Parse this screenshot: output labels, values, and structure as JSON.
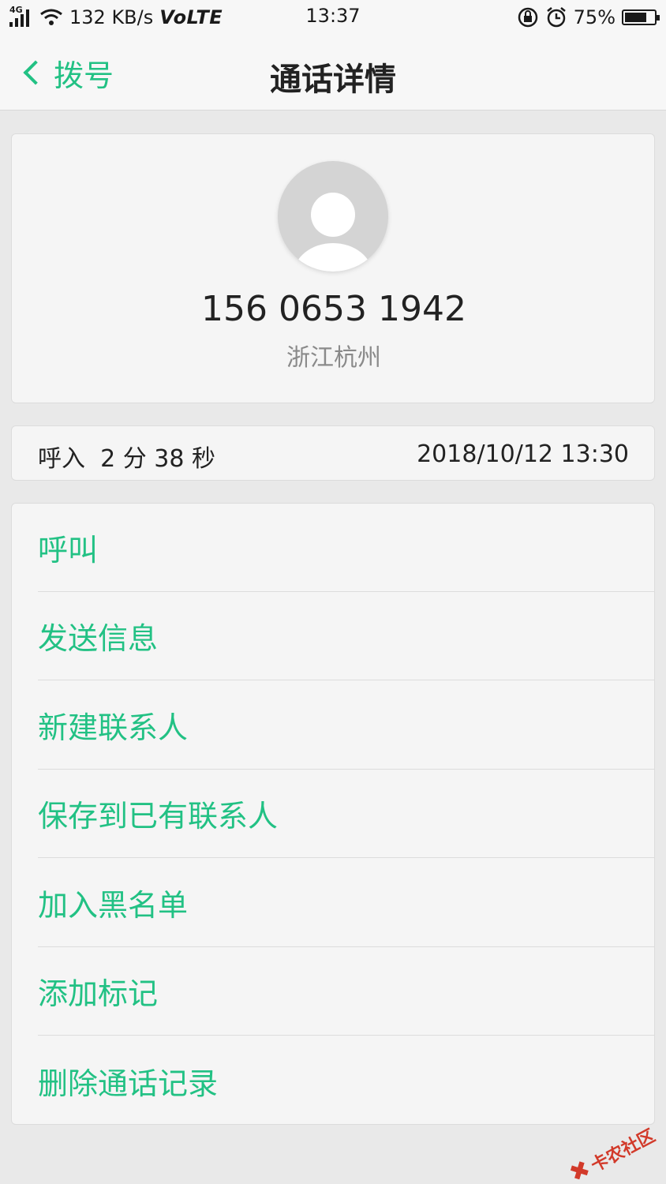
{
  "status_bar": {
    "network": "4G",
    "speed": "132 KB/s",
    "volte": "VoLTE",
    "time": "13:37",
    "battery": "75%",
    "battery_level": 0.75
  },
  "header": {
    "back_label": "拨号",
    "title": "通话详情"
  },
  "contact": {
    "number": "156 0653 1942",
    "location": "浙江杭州"
  },
  "call_log": {
    "type_duration": "呼入  2 分 38 秒",
    "datetime": "2018/10/12 13:30"
  },
  "actions": [
    {
      "label": "呼叫"
    },
    {
      "label": "发送信息"
    },
    {
      "label": "新建联系人"
    },
    {
      "label": "保存到已有联系人"
    },
    {
      "label": "加入黑名单"
    },
    {
      "label": "添加标记"
    },
    {
      "label": "删除通话记录"
    }
  ],
  "watermark": "卡农社区",
  "colors": {
    "accent": "#22c184",
    "background": "#e9e9e9",
    "card": "#f5f5f5"
  }
}
